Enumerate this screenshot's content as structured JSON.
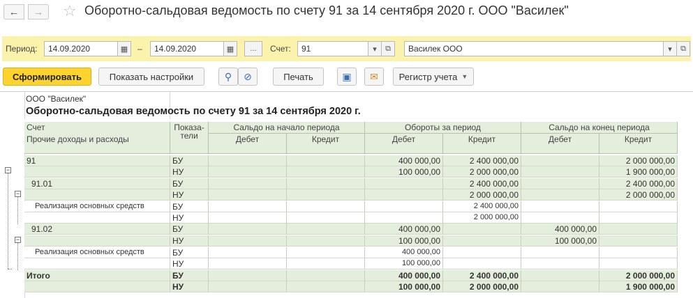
{
  "window": {
    "title": "Оборотно-сальдовая ведомость по счету 91 за 14 сентября 2020 г. ООО \"Василек\"",
    "back_icon": "arrow-left-icon",
    "forward_icon": "arrow-right-icon",
    "favorite_icon": "star-icon"
  },
  "filter": {
    "period_label": "Период:",
    "date_from": "14.09.2020",
    "dash": "–",
    "date_to": "14.09.2020",
    "more_button": "...",
    "account_label": "Счет:",
    "account_value": "91",
    "organization_value": "Василек ООО"
  },
  "toolbar": {
    "generate_label": "Сформировать",
    "settings_label": "Показать настройки",
    "print_label": "Печать",
    "register_label": "Регистр учета"
  },
  "report": {
    "organization": "ООО \"Василек\"",
    "title": "Оборотно-сальдовая ведомость по счету 91 за 14 сентября 2020 г.",
    "headers": {
      "account": "Счет",
      "account_sub": "Прочие доходы и расходы",
      "indicators_1": "Показа-",
      "indicators_2": "тели",
      "opening": "Сальдо на начало периода",
      "turnover": "Обороты за период",
      "closing": "Сальдо на конец периода",
      "debit": "Дебет",
      "credit": "Кредит"
    },
    "rows": [
      {
        "name": "91",
        "ind": "БУ",
        "od": "",
        "oc": "",
        "td": "400 000,00",
        "tc": "2 400 000,00",
        "cd": "",
        "cc": "2 000 000,00"
      },
      {
        "name": "",
        "ind": "НУ",
        "od": "",
        "oc": "",
        "td": "100 000,00",
        "tc": "2 000 000,00",
        "cd": "",
        "cc": "1 900 000,00"
      },
      {
        "name": "91.01",
        "ind": "БУ",
        "od": "",
        "oc": "",
        "td": "",
        "tc": "2 400 000,00",
        "cd": "",
        "cc": "2 400 000,00"
      },
      {
        "name": "",
        "ind": "НУ",
        "od": "",
        "oc": "",
        "td": "",
        "tc": "2 000 000,00",
        "cd": "",
        "cc": "2 000 000,00"
      },
      {
        "name": "Реализация основных средств",
        "ind": "БУ",
        "od": "",
        "oc": "",
        "td": "",
        "tc": "2 400 000,00",
        "cd": "",
        "cc": ""
      },
      {
        "name": "",
        "ind": "НУ",
        "od": "",
        "oc": "",
        "td": "",
        "tc": "2 000 000,00",
        "cd": "",
        "cc": ""
      },
      {
        "name": "91.02",
        "ind": "БУ",
        "od": "",
        "oc": "",
        "td": "400 000,00",
        "tc": "",
        "cd": "400 000,00",
        "cc": ""
      },
      {
        "name": "",
        "ind": "НУ",
        "od": "",
        "oc": "",
        "td": "100 000,00",
        "tc": "",
        "cd": "100 000,00",
        "cc": ""
      },
      {
        "name": "Реализация основных средств",
        "ind": "БУ",
        "od": "",
        "oc": "",
        "td": "400 000,00",
        "tc": "",
        "cd": "",
        "cc": ""
      },
      {
        "name": "",
        "ind": "НУ",
        "od": "",
        "oc": "",
        "td": "100 000,00",
        "tc": "",
        "cd": "",
        "cc": ""
      },
      {
        "name": "Итого",
        "ind": "БУ",
        "od": "",
        "oc": "",
        "td": "400 000,00",
        "tc": "2 400 000,00",
        "cd": "",
        "cc": "2 000 000,00"
      },
      {
        "name": "",
        "ind": "НУ",
        "od": "",
        "oc": "",
        "td": "100 000,00",
        "tc": "2 000 000,00",
        "cd": "",
        "cc": "1 900 000,00"
      }
    ]
  },
  "colors": {
    "header_green": "#e5eedc",
    "filter_yellow": "#fbf2ab",
    "primary_button": "#ffd32e"
  }
}
